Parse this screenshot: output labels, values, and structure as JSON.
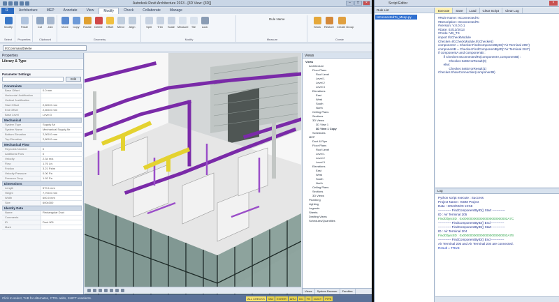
{
  "app": {
    "title": "Autodesk Revit Architecture 2013 - [3D View: {3D}]",
    "window_controls": [
      "–",
      "□",
      "×"
    ],
    "tabs": [
      "Architecture",
      "MEP",
      "Annotate",
      "View",
      "Modify",
      "Check",
      "Collaborate",
      "Manage"
    ],
    "ribbon_buttons": [
      "Modify",
      "Paste",
      "Cut",
      "Join",
      "Move",
      "Copy",
      "Rotate",
      "Delete",
      "Offset",
      "Mirror",
      "Align",
      "Split",
      "Trim",
      "Scale",
      "Measure",
      "Tile",
      "Lock",
      "Show",
      "Restore",
      "Create Group",
      "Create Similar",
      "Pin",
      "Unpin"
    ],
    "ribbon_groups": [
      "Select",
      "Properties",
      "Clipboard",
      "Geometry",
      "Modify",
      "Measure",
      "Create"
    ],
    "option_label": "Rule Name",
    "command_selector": "IfcCommandDelete",
    "properties_header": "Properties",
    "type_selector": "Library & Type",
    "edit_button": "Edit",
    "param_header": "Parameter Settings",
    "sections": [
      {
        "name": "Constraints",
        "rows": [
          [
            "Base Offset",
            "0.0 mm"
          ],
          [
            "Horizontal Justification",
            ""
          ],
          [
            "Vertical Justification",
            ""
          ],
          [
            "Start Offset",
            "2,600.0 mm"
          ],
          [
            "End Offset",
            "2,600.0 mm"
          ],
          [
            "Base Level",
            "Level 3"
          ]
        ]
      },
      {
        "name": "Mechanical",
        "rows": [
          [
            "System Type",
            "Supply Air"
          ],
          [
            "System Name",
            "Mechanical Supply Air"
          ],
          [
            "Bottom Elevation",
            "2,500.0 mm"
          ],
          [
            "Top Elevation",
            "2,800.0 mm"
          ]
        ]
      },
      {
        "name": "Mechanical Flow",
        "rows": [
          [
            "Reynolds Number",
            "0"
          ],
          [
            "Additional Flow",
            "0"
          ],
          [
            "Velocity",
            "2.34 m/s"
          ],
          [
            "Flow",
            "1.76 L/s"
          ],
          [
            "Friction",
            "3.21 Pa/m"
          ],
          [
            "Velocity Pressure",
            "0.00 Pa"
          ],
          [
            "Pressure Drop",
            "1.92 Pa"
          ]
        ]
      },
      {
        "name": "Dimensions",
        "rows": [
          [
            "Length",
            "570.1 mm"
          ],
          [
            "Height",
            "7,700.0 mm"
          ],
          [
            "Width",
            "600.0 mm"
          ],
          [
            "Size",
            "600x300"
          ]
        ]
      },
      {
        "name": "Identity Data",
        "rows": [
          [
            "Name",
            "Rectangular Duct"
          ],
          [
            "Comments",
            ""
          ],
          [
            "ID",
            "Duct 001"
          ],
          [
            "Mark",
            ""
          ]
        ]
      }
    ],
    "browser_header": "Views",
    "browser_tree": [
      {
        "label": "Views",
        "level": 0,
        "bold": true
      },
      {
        "label": "Architecture",
        "level": 1
      },
      {
        "label": "Floor Plans",
        "level": 2
      },
      {
        "label": "Roof Level",
        "level": 3
      },
      {
        "label": "Level 1",
        "level": 3
      },
      {
        "label": "Level 2",
        "level": 3
      },
      {
        "label": "Level 3",
        "level": 3
      },
      {
        "label": "Elevations",
        "level": 2
      },
      {
        "label": "East",
        "level": 3
      },
      {
        "label": "West",
        "level": 3
      },
      {
        "label": "South",
        "level": 3
      },
      {
        "label": "North",
        "level": 3
      },
      {
        "label": "Ceiling Plans",
        "level": 2
      },
      {
        "label": "Sections",
        "level": 2
      },
      {
        "label": "3D Views",
        "level": 2
      },
      {
        "label": "3D View 1",
        "level": 3
      },
      {
        "label": "3D View 1 Copy",
        "level": 3,
        "bold": true
      },
      {
        "label": "Schedules",
        "level": 2
      },
      {
        "label": "MEP",
        "level": 1
      },
      {
        "label": "Duct & Pipe",
        "level": 2
      },
      {
        "label": "Floor Plans",
        "level": 2
      },
      {
        "label": "Roof Level",
        "level": 3
      },
      {
        "label": "Level 1",
        "level": 3
      },
      {
        "label": "Level 2",
        "level": 3
      },
      {
        "label": "Level 3",
        "level": 3
      },
      {
        "label": "Elevations",
        "level": 2
      },
      {
        "label": "East",
        "level": 3
      },
      {
        "label": "West",
        "level": 3
      },
      {
        "label": "South",
        "level": 3
      },
      {
        "label": "North",
        "level": 3
      },
      {
        "label": "Ceiling Plans",
        "level": 2
      },
      {
        "label": "Sections",
        "level": 2
      },
      {
        "label": "3D Views",
        "level": 2
      },
      {
        "label": "Plumbing",
        "level": 1
      },
      {
        "label": "Lighting",
        "level": 1
      },
      {
        "label": "Legends",
        "level": 1
      },
      {
        "label": "Sheets",
        "level": 1
      },
      {
        "label": "Drafting Views",
        "level": 1
      },
      {
        "label": "Schedules/Quantities",
        "level": 1
      }
    ],
    "browser_tabs": [
      "Views",
      "System Browser",
      "Families"
    ],
    "status_message": "Click to select, TAB for alternates, CTRL adds, SHIFT unselects.",
    "status_buttons": [
      "ALL CHECKS",
      "VAV",
      "ENTER",
      "AHU",
      "DC",
      "FE",
      "DUCT",
      "PIPE"
    ]
  },
  "script_panel": {
    "title": "Script Editor",
    "close_label": "×",
    "rule_list_header": "Rule List",
    "rule_item": "IsConnectedTo_Meep.py",
    "toolbar": [
      "Execute",
      "Save",
      "Load",
      "Clear Script",
      "Clear Log"
    ],
    "code": [
      "#Rule Name: IsConnectedTo",
      "#Description: IsConnectedTo",
      "#Version: V.0.0.0.1",
      "#Date: 02/13/2013",
      "#Code: VB_TS",
      "import IfcCheckModule",
      "Checker=IfcCheckModule.IfcChecker()",
      "componentA = Checker.FindComponentByID(\"Air Terminal 205\")",
      "componentB = Checker.FindComponentByID(\"Air Terminal 204\")",
      "",
      "if componentA and componentB :",
      "      if Checker.IsConnectedTo(componentA,componentB) :",
      "            Checker.SetErrorResult(0)",
      "      else:",
      "            Checker.SetErrorResult(1)",
      "Checker.ShowConnection(componentB)"
    ],
    "log_header": "Log",
    "log": [
      {
        "text": "Python script execute : Success",
        "style": "n"
      },
      {
        "text": "Project Name :  KBIM Project",
        "style": "n"
      },
      {
        "text": "Date : 2013/02/20 13:58",
        "style": "n"
      },
      {
        "text": "------------ FindComponentByID() Start ------------",
        "style": "n"
      },
      {
        "text": "ID : Air Terminal 205",
        "style": "n"
      },
      {
        "text": "FindObjectID : 0x0000000000000000000000003A7C",
        "style": "g"
      },
      {
        "text": "------------ FindComponentByID() End ------------",
        "style": "n"
      },
      {
        "text": "------------ FindComponentByID() Start ------------",
        "style": "n"
      },
      {
        "text": "ID : Air Terminal 204",
        "style": "n"
      },
      {
        "text": "FindObjectID : 0x0000000000000000000000003A7B",
        "style": "g"
      },
      {
        "text": "------------ FindComponentByID() End ------------",
        "style": "n"
      },
      {
        "text": "Air Terminal 205 and Air Terminal 204 are connected.",
        "style": "n"
      },
      {
        "text": "Result = TRUE",
        "style": "c"
      }
    ]
  },
  "colors": {
    "duct_purple": "#7a2aa8",
    "duct_yellow": "#e4d230",
    "selection_blue": "#2e6fd0",
    "status_bar": "#5b7299"
  }
}
